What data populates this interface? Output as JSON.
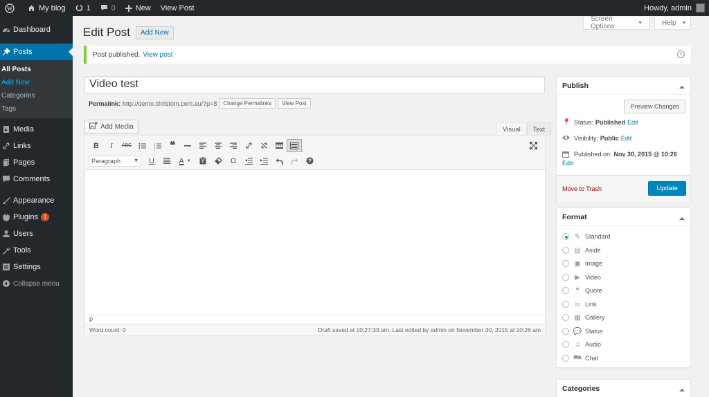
{
  "adminbar": {
    "site_name": "My blog",
    "updates_count": "1",
    "comments_count": "0",
    "new_label": "New",
    "view_post_label": "View Post",
    "howdy": "Howdy, admin"
  },
  "sidebar": {
    "items": [
      {
        "label": "Dashboard",
        "icon": "dashboard-icon"
      },
      {
        "label": "Posts",
        "icon": "pushpin-icon"
      },
      {
        "label": "Media",
        "icon": "media-icon"
      },
      {
        "label": "Links",
        "icon": "link-icon"
      },
      {
        "label": "Pages",
        "icon": "pages-icon"
      },
      {
        "label": "Comments",
        "icon": "comment-icon"
      },
      {
        "label": "Appearance",
        "icon": "paintbrush-icon"
      },
      {
        "label": "Plugins",
        "icon": "plugin-icon",
        "badge": "1"
      },
      {
        "label": "Users",
        "icon": "users-icon"
      },
      {
        "label": "Tools",
        "icon": "wrench-icon"
      },
      {
        "label": "Settings",
        "icon": "settings-icon"
      }
    ],
    "posts_submenu": [
      "All Posts",
      "Add New",
      "Categories",
      "Tags"
    ],
    "collapse_label": "Collapse menu"
  },
  "screen_options_label": "Screen Options",
  "help_label": "Help",
  "page_title": "Edit Post",
  "add_new_label": "Add New",
  "notice": {
    "text": "Post published.",
    "link": "View post"
  },
  "post": {
    "title": "Video test",
    "permalink_label": "Permalink:",
    "permalink_url": "http://demo.christom.com.au/?p=8",
    "change_permalinks": "Change Permalinks",
    "view_post": "View Post"
  },
  "editor": {
    "add_media_label": "Add Media",
    "tab_visual": "Visual",
    "tab_text": "Text",
    "format_select": "Paragraph",
    "path": "p",
    "word_count": "Word count: 0",
    "draft_saved": "Draft saved at 10:27:33 am. Last edited by admin on November 30, 2015 at 10:26 am"
  },
  "publish": {
    "heading": "Publish",
    "preview_label": "Preview Changes",
    "status_label": "Status:",
    "status_value": "Published",
    "visibility_label": "Visibility:",
    "visibility_value": "Public",
    "published_label": "Published on:",
    "published_value": "Nov 30, 2015 @ 10:26",
    "edit_label": "Edit",
    "trash_label": "Move to Trash",
    "update_label": "Update"
  },
  "format": {
    "heading": "Format",
    "options": [
      "Standard",
      "Aside",
      "Image",
      "Video",
      "Quote",
      "Link",
      "Gallery",
      "Status",
      "Audio",
      "Chat"
    ],
    "selected": "Standard"
  },
  "categories_heading": "Categories",
  "colors": {
    "adminbar_bg": "#23282d",
    "accent": "#0073aa",
    "update_button": "#0085ba",
    "notice_success": "#7ad03a",
    "trash": "#a00"
  }
}
